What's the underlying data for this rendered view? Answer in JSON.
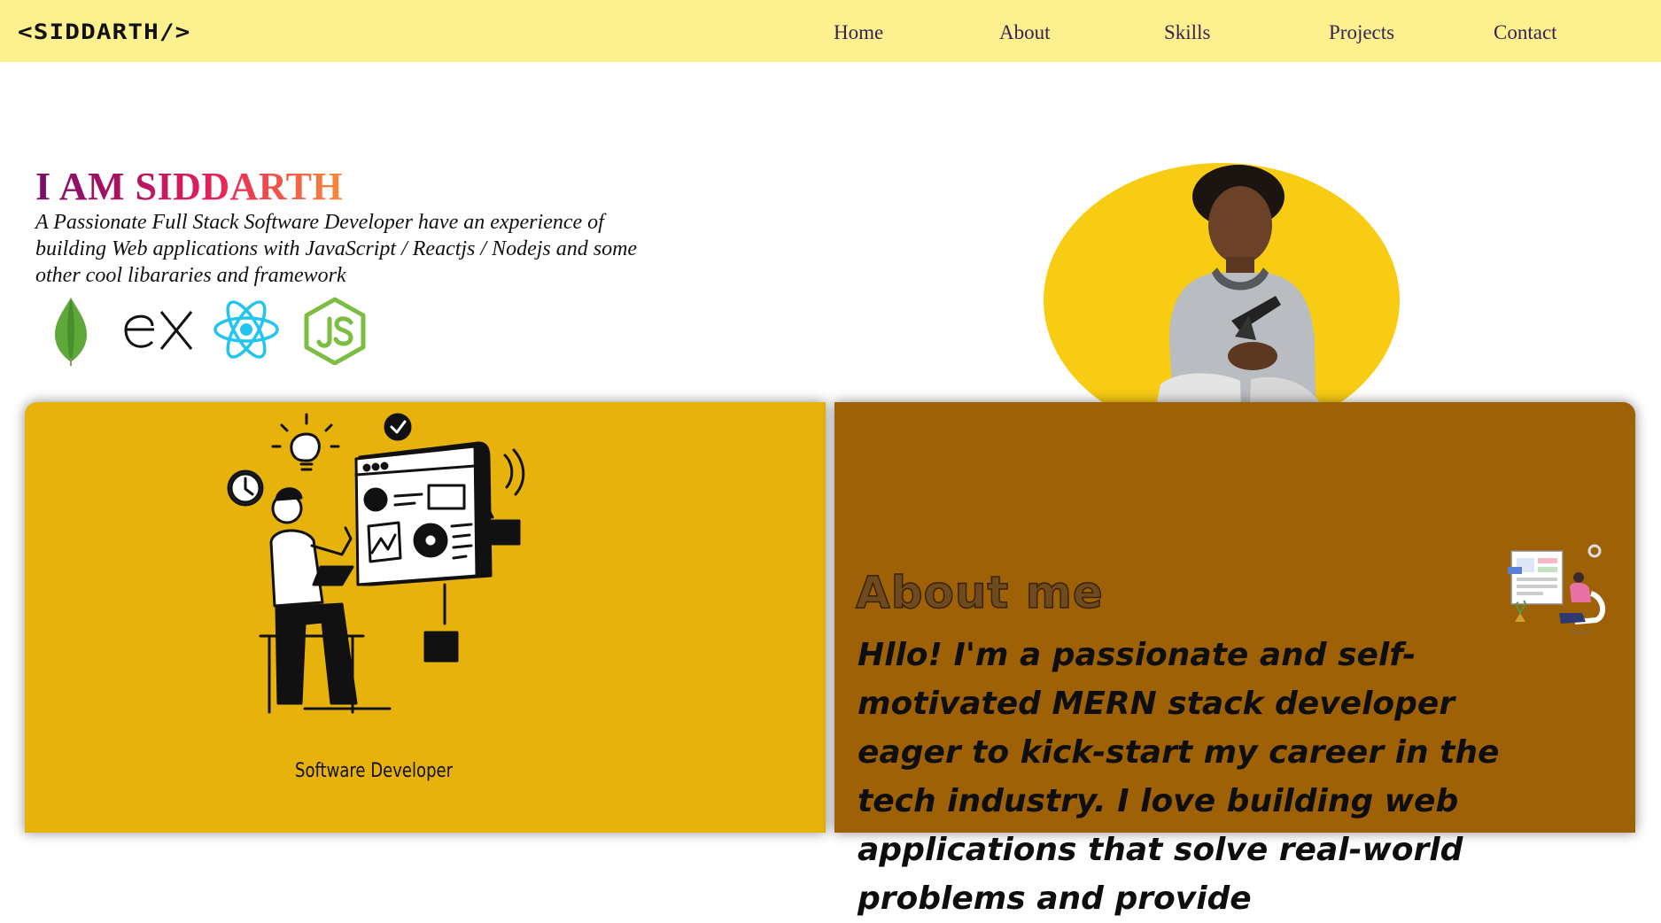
{
  "navbar": {
    "logo": "<SIDDARTH/>",
    "links": [
      "Home",
      "About",
      "Skills",
      "Projects",
      "Contact"
    ]
  },
  "hero": {
    "title": "I AM SIDDARTH",
    "description": "A Passionate Full Stack Software Developer have an experience of building Web applications with JavaScript / Reactjs / Nodejs and some other cool libararies and framework",
    "tech_icons": [
      "mongodb-icon",
      "express-icon",
      "react-icon",
      "nodejs-icon"
    ]
  },
  "skills_card": {
    "role_label": "Software Developer"
  },
  "about": {
    "title": "About me",
    "text": "Hllo! I'm a passionate and self-motivated MERN stack developer eager to kick-start my career in the tech industry. I love building web applications that solve real-world problems and provide"
  },
  "colors": {
    "navbar_bg": "#fdf08e",
    "nav_text": "#3a1f52",
    "photo_circle": "#f8cc13",
    "card_left_bg": "#e6b20b",
    "card_right_bg": "#9e6106"
  }
}
